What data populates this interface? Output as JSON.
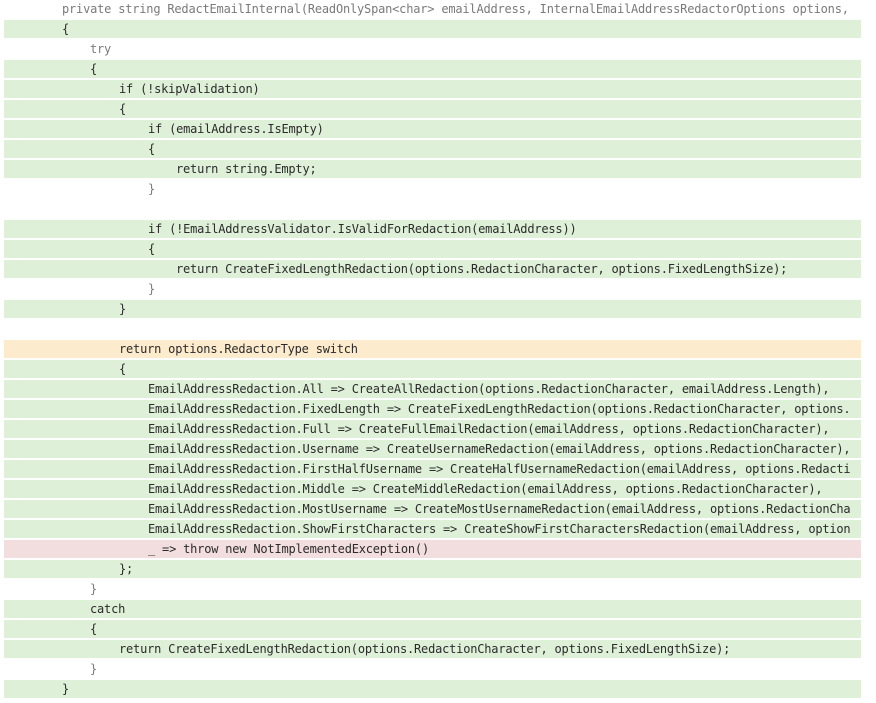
{
  "code_view": {
    "lines": [
      {
        "text": "private string RedactEmailInternal(ReadOnlySpan<char> emailAddress, InternalEmailAddressRedactorOptions options,",
        "coverage": "neutral"
      },
      {
        "text": "{",
        "coverage": "covered"
      },
      {
        "text": "try",
        "coverage": "neutral"
      },
      {
        "text": "{",
        "coverage": "covered"
      },
      {
        "text": "if (!skipValidation)",
        "coverage": "covered"
      },
      {
        "text": "{",
        "coverage": "covered"
      },
      {
        "text": "if (emailAddress.IsEmpty)",
        "coverage": "covered"
      },
      {
        "text": "{",
        "coverage": "covered"
      },
      {
        "text": "return string.Empty;",
        "coverage": "covered"
      },
      {
        "text": "}",
        "coverage": "neutral"
      },
      {
        "text": "",
        "coverage": "neutral"
      },
      {
        "text": "if (!EmailAddressValidator.IsValidForRedaction(emailAddress))",
        "coverage": "covered"
      },
      {
        "text": "{",
        "coverage": "covered"
      },
      {
        "text": "return CreateFixedLengthRedaction(options.RedactionCharacter, options.FixedLengthSize);",
        "coverage": "covered"
      },
      {
        "text": "}",
        "coverage": "neutral"
      },
      {
        "text": "}",
        "coverage": "covered"
      },
      {
        "text": "",
        "coverage": "neutral"
      },
      {
        "text": "return options.RedactorType switch",
        "coverage": "partial"
      },
      {
        "text": "{",
        "coverage": "covered"
      },
      {
        "text": "EmailAddressRedaction.All => CreateAllRedaction(options.RedactionCharacter, emailAddress.Length),",
        "coverage": "covered"
      },
      {
        "text": "EmailAddressRedaction.FixedLength => CreateFixedLengthRedaction(options.RedactionCharacter, options.",
        "coverage": "covered"
      },
      {
        "text": "EmailAddressRedaction.Full => CreateFullEmailRedaction(emailAddress, options.RedactionCharacter),",
        "coverage": "covered"
      },
      {
        "text": "EmailAddressRedaction.Username => CreateUsernameRedaction(emailAddress, options.RedactionCharacter),",
        "coverage": "covered"
      },
      {
        "text": "EmailAddressRedaction.FirstHalfUsername => CreateHalfUsernameRedaction(emailAddress, options.Redacti",
        "coverage": "covered"
      },
      {
        "text": "EmailAddressRedaction.Middle => CreateMiddleRedaction(emailAddress, options.RedactionCharacter),",
        "coverage": "covered"
      },
      {
        "text": "EmailAddressRedaction.MostUsername => CreateMostUsernameRedaction(emailAddress, options.RedactionCha",
        "coverage": "covered"
      },
      {
        "text": "EmailAddressRedaction.ShowFirstCharacters => CreateShowFirstCharactersRedaction(emailAddress, option",
        "coverage": "covered"
      },
      {
        "text": "_ => throw new NotImplementedException()",
        "coverage": "uncovered"
      },
      {
        "text": "};",
        "coverage": "covered"
      },
      {
        "text": "}",
        "coverage": "neutral"
      },
      {
        "text": "catch",
        "coverage": "covered"
      },
      {
        "text": "{",
        "coverage": "covered"
      },
      {
        "text": "return CreateFixedLengthRedaction(options.RedactionCharacter, options.FixedLengthSize);",
        "coverage": "covered"
      },
      {
        "text": "}",
        "coverage": "neutral"
      },
      {
        "text": "}",
        "coverage": "covered"
      }
    ]
  }
}
